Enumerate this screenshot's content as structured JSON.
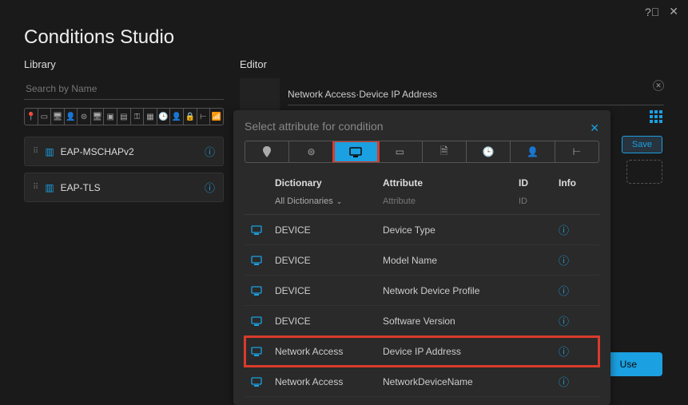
{
  "header": {
    "title": "Conditions Studio"
  },
  "library": {
    "label": "Library",
    "search_placeholder": "Search by Name",
    "items": [
      {
        "name": "EAP-MSCHAPv2"
      },
      {
        "name": "EAP-TLS"
      }
    ]
  },
  "editor": {
    "label": "Editor",
    "field_value": "Network Access·Device IP Address",
    "save_label": "Save",
    "use_label": "Use"
  },
  "modal": {
    "title": "Select attribute for condition",
    "columns": {
      "dict": "Dictionary",
      "attr": "Attribute",
      "id": "ID",
      "info": "Info"
    },
    "filters": {
      "dict": "All Dictionaries",
      "attr": "Attribute",
      "id": "ID"
    },
    "rows": [
      {
        "dict": "DEVICE",
        "attr": "Device Type"
      },
      {
        "dict": "DEVICE",
        "attr": "Model Name"
      },
      {
        "dict": "DEVICE",
        "attr": "Network Device Profile"
      },
      {
        "dict": "DEVICE",
        "attr": "Software Version"
      },
      {
        "dict": "Network Access",
        "attr": "Device IP Address",
        "highlight": true
      },
      {
        "dict": "Network Access",
        "attr": "NetworkDeviceName"
      }
    ]
  }
}
